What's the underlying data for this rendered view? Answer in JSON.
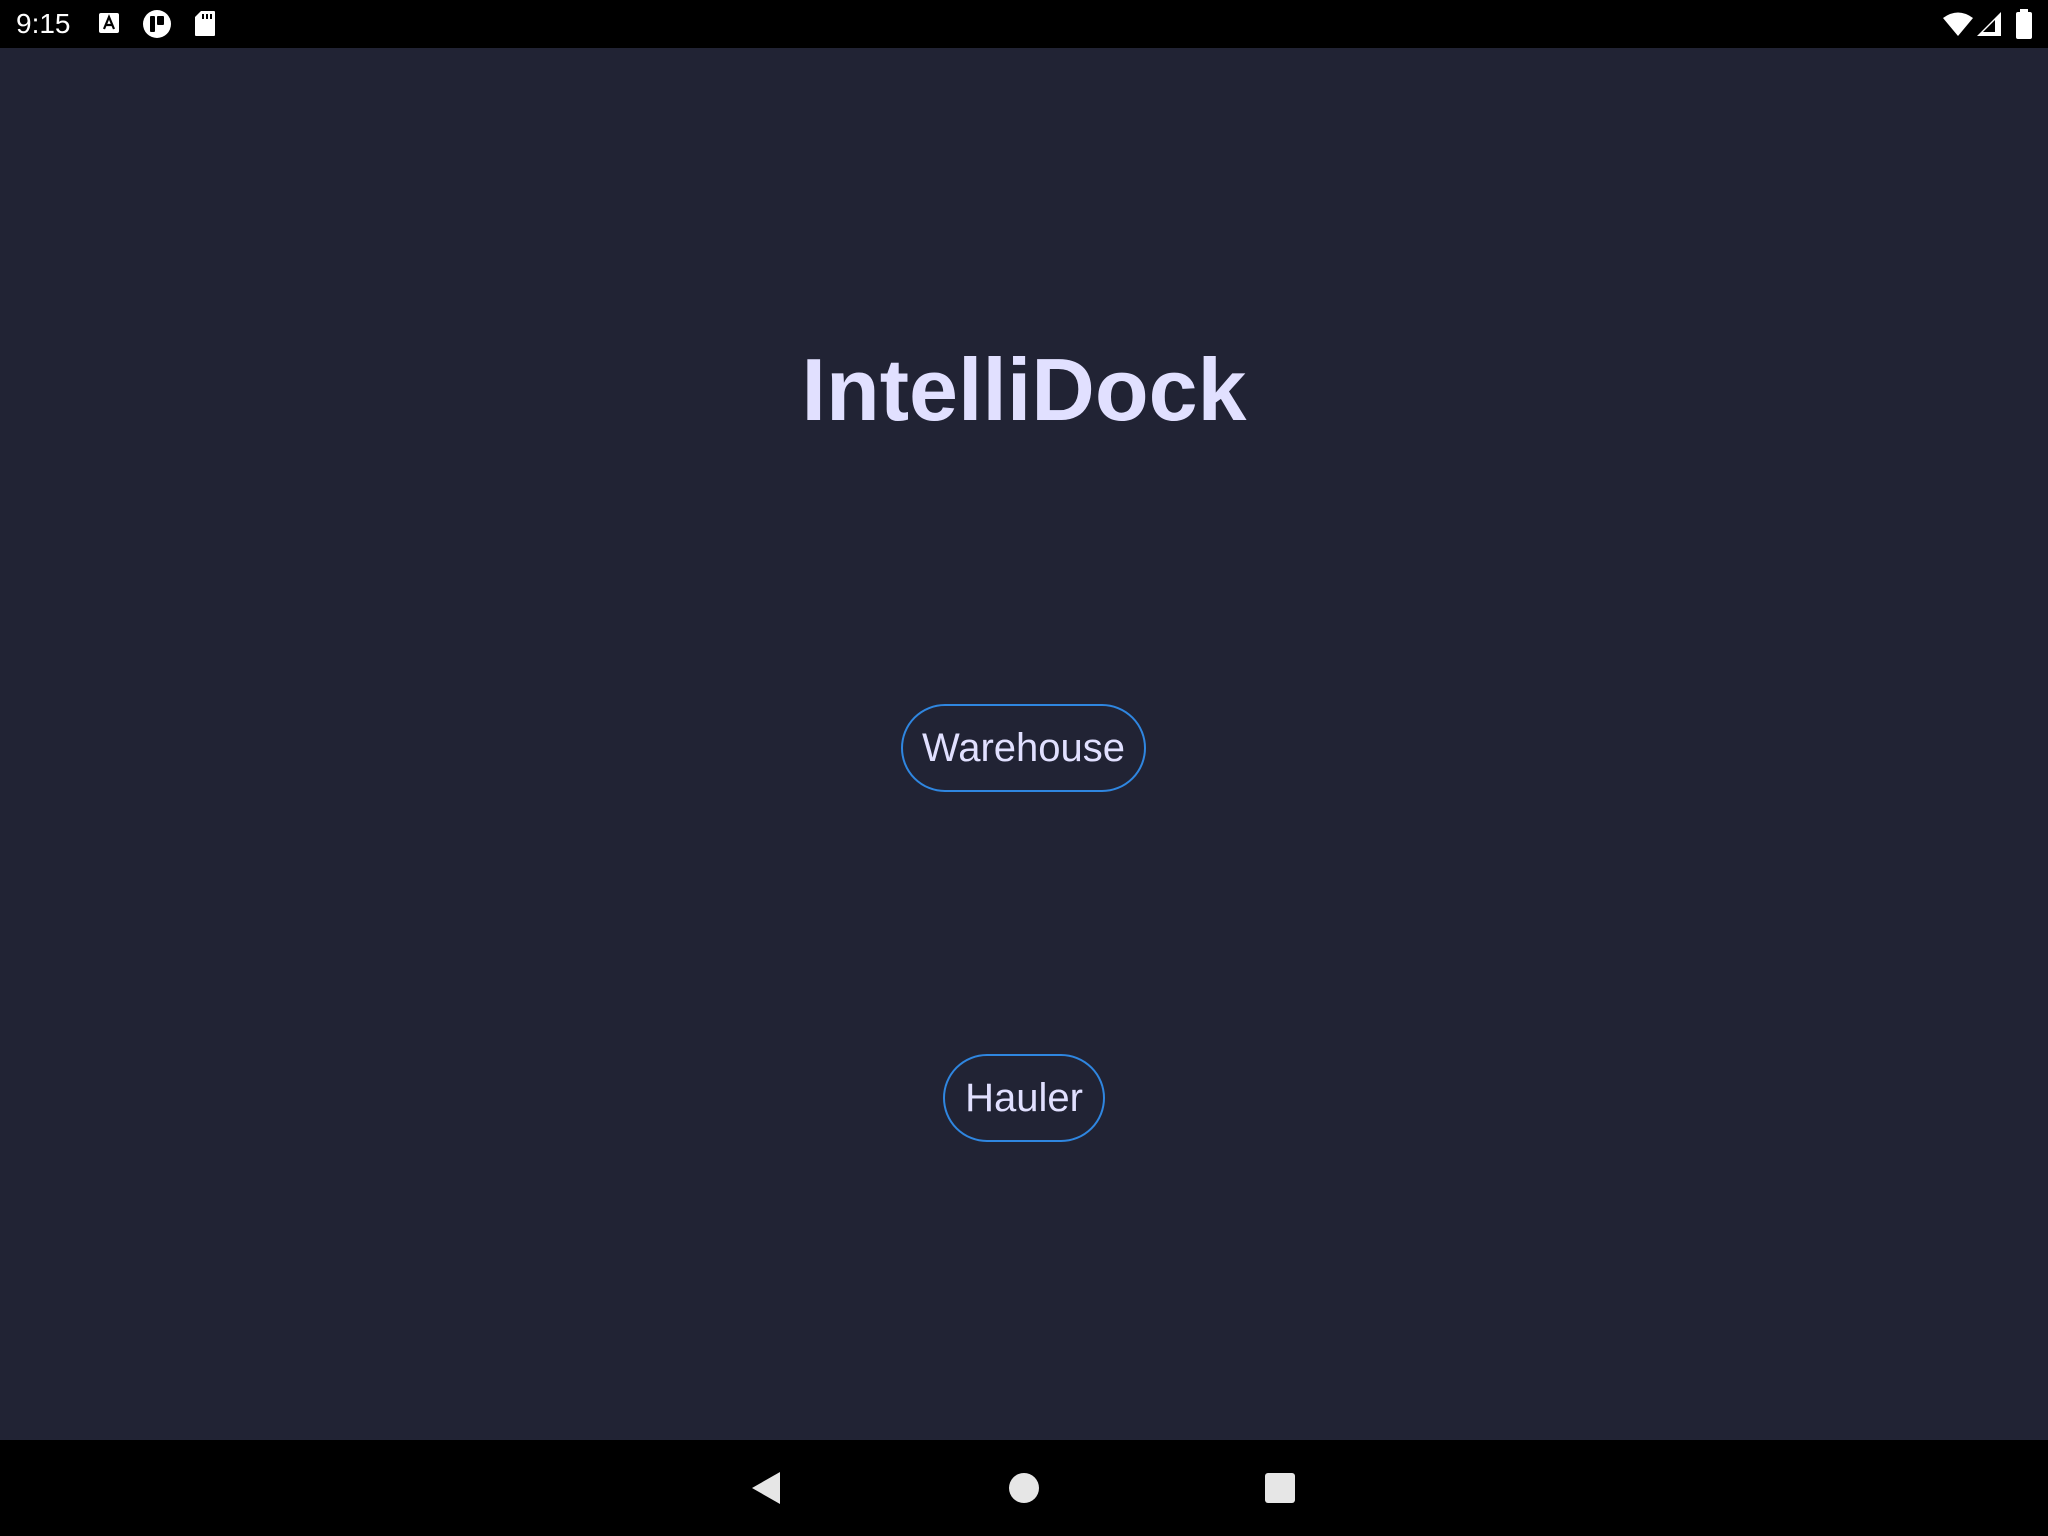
{
  "status_bar": {
    "time": "9:15",
    "left_icons": [
      "font-a-icon",
      "app-notification-icon",
      "sd-card-icon"
    ],
    "right_icons": [
      "wifi-icon",
      "cell-signal-icon",
      "battery-icon"
    ]
  },
  "app": {
    "title": "IntelliDock",
    "buttons": {
      "warehouse_label": "Warehouse",
      "hauler_label": "Hauler"
    }
  },
  "nav_bar": {
    "buttons": [
      "back-icon",
      "home-icon",
      "recents-icon"
    ]
  },
  "colors": {
    "background": "#212334",
    "title_text": "#e1e0ff",
    "button_border": "#2f86e0",
    "system_bars": "#000000"
  }
}
